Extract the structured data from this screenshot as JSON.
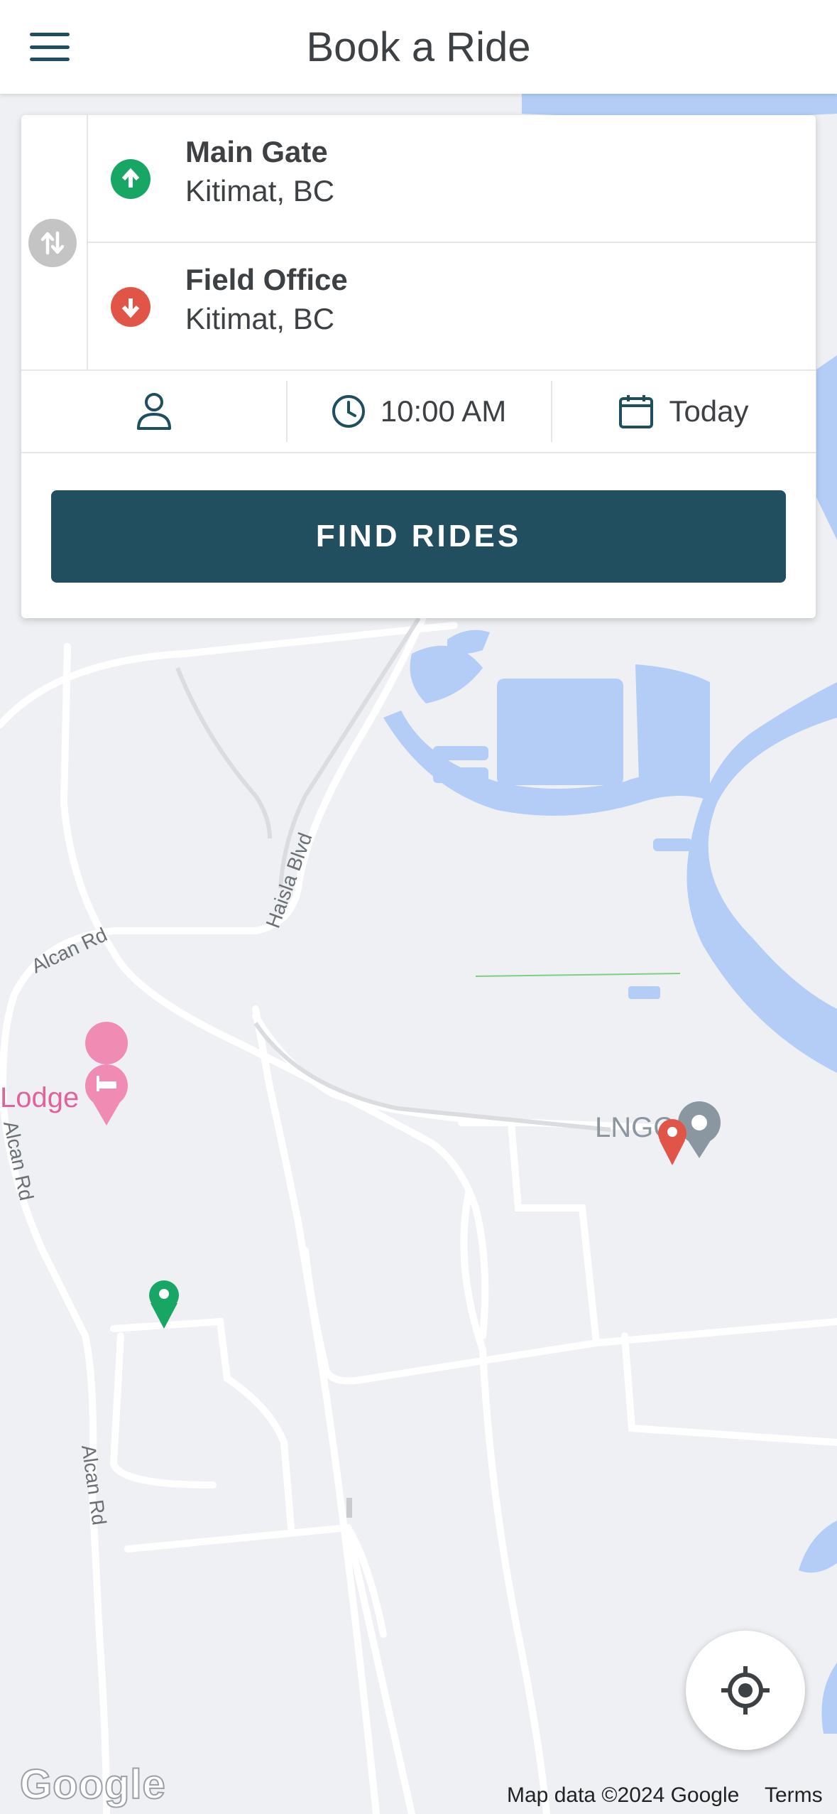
{
  "header": {
    "title": "Book a Ride",
    "menu_icon": "hamburger-menu-icon"
  },
  "trip": {
    "from": {
      "name": "Main Gate",
      "city": "Kitimat, BC",
      "color": "#17a663"
    },
    "to": {
      "name": "Field Office",
      "city": "Kitimat, BC",
      "color": "#e15448"
    },
    "swap_icon": "swap-vertical-icon"
  },
  "options": {
    "passenger_icon": "person-icon",
    "time": "10:00 AM",
    "date": "Today"
  },
  "find_button": "FIND RIDES",
  "map": {
    "labels": {
      "alcan_rd_1": "Alcan Rd",
      "alcan_rd_2": "Alcan Rd",
      "alcan_rd_3": "Alcan Rd",
      "haisla_blvd": "Haisla Blvd",
      "lodge": "Lodge",
      "lng": "LNGC"
    },
    "attribution": "Map data ©2024 Google",
    "terms": "Terms",
    "logo": "Google"
  },
  "colors": {
    "accent": "#224f60",
    "water": "#b3cdf7",
    "map_bg": "#eef0f3"
  }
}
